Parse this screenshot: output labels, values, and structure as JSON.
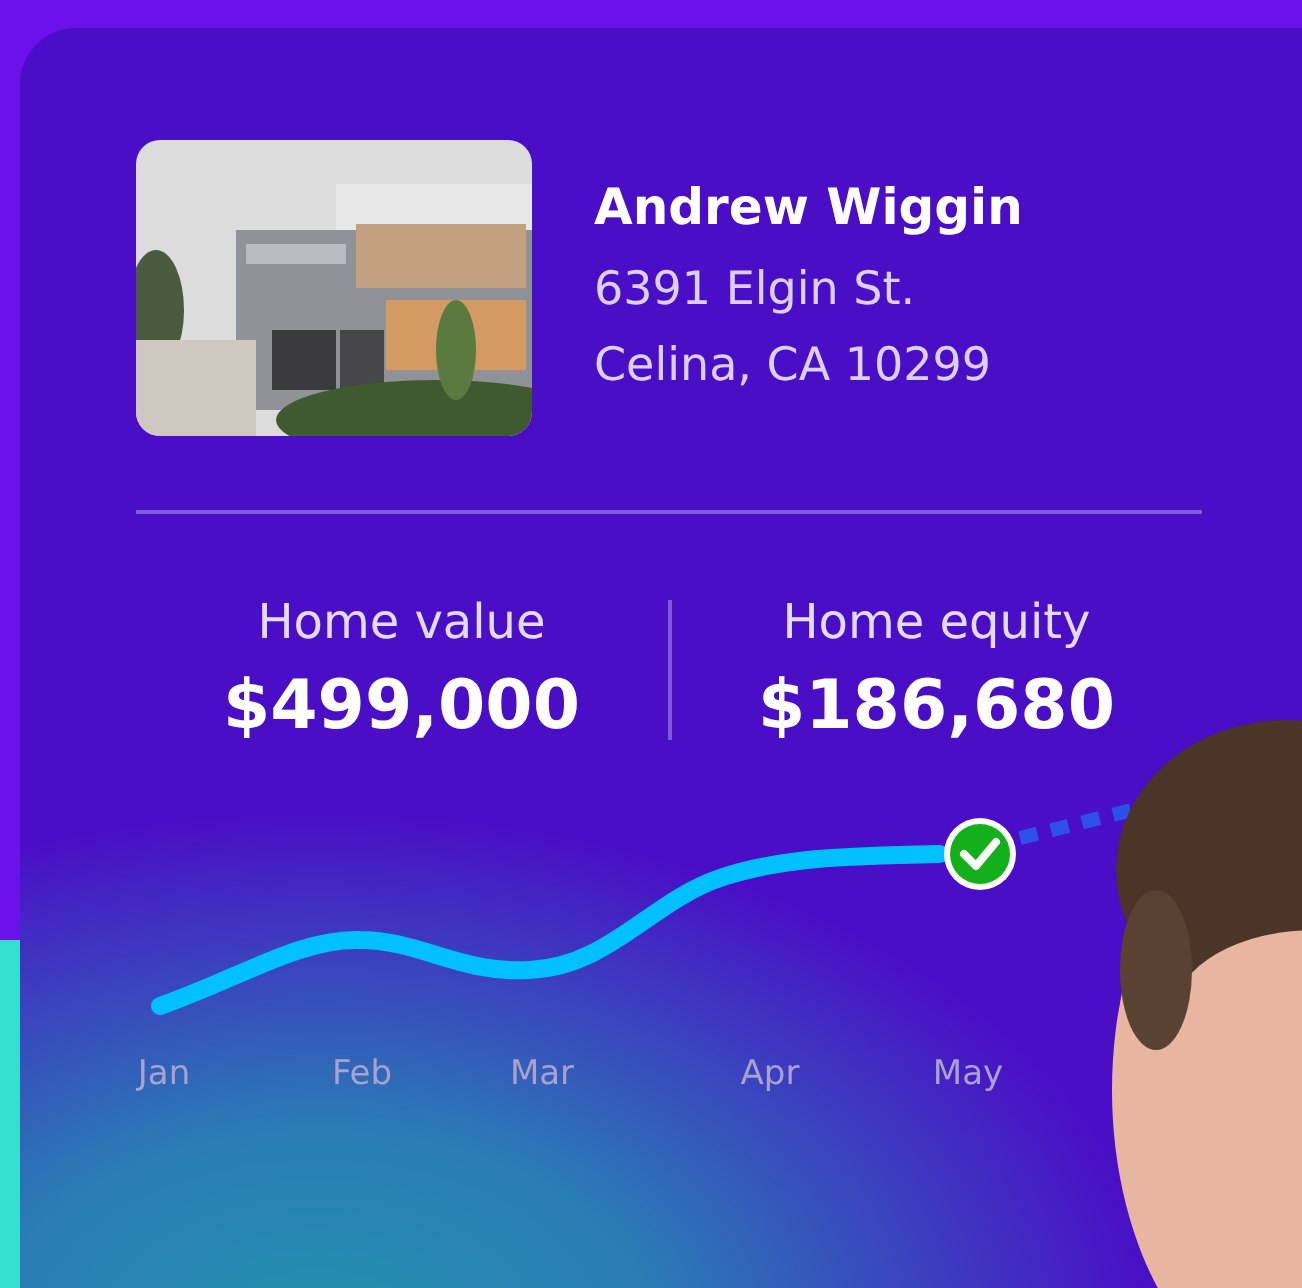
{
  "owner": {
    "name": "Andrew Wiggin",
    "address_lines": [
      "6391 Elgin St.",
      "Celina, CA 10299"
    ]
  },
  "stats": [
    {
      "label": "Home value",
      "value": "$499,000"
    },
    {
      "label": "Home equity",
      "value": "$186,680"
    }
  ],
  "chart": {
    "months": [
      "Jan",
      "Feb",
      "Mar",
      "Apr",
      "May"
    ]
  }
}
